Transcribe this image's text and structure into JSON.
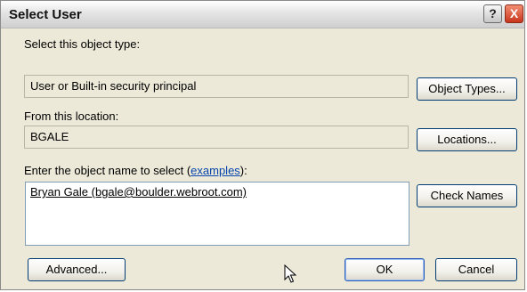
{
  "window": {
    "title": "Select User"
  },
  "object_type": {
    "label": "Select this object type:",
    "value": "User or Built-in security principal",
    "button": "Object Types..."
  },
  "location": {
    "label": "From this location:",
    "value": "BGALE",
    "button": "Locations..."
  },
  "object_name": {
    "label_prefix": "Enter the object name to select (",
    "link": "examples",
    "label_suffix": "):",
    "value": "Bryan Gale (bgale@boulder.webroot.com)"
  },
  "buttons": {
    "check_names": "Check Names",
    "advanced": "Advanced...",
    "ok": "OK",
    "cancel": "Cancel"
  },
  "title_buttons": {
    "help": "?",
    "close": "X"
  }
}
